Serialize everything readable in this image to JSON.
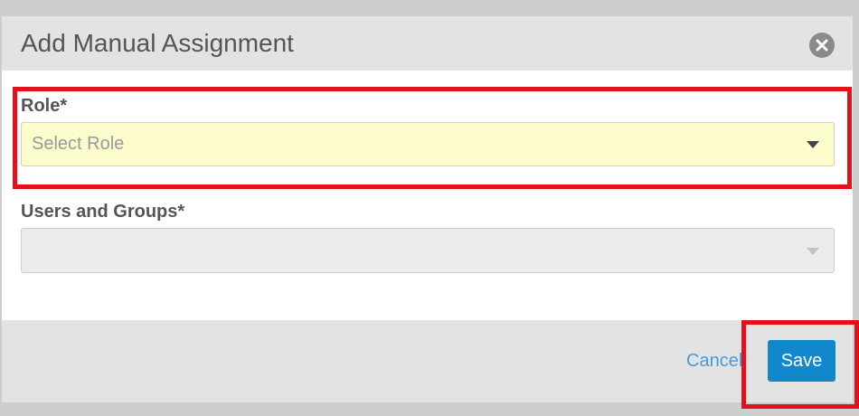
{
  "dialog": {
    "title": "Add Manual Assignment",
    "close_icon": "close-icon"
  },
  "form": {
    "role": {
      "label": "Role*",
      "placeholder": "Select Role",
      "value": "",
      "caret_icon": "caret-down-icon"
    },
    "users_groups": {
      "label": "Users and Groups*",
      "value": "",
      "disabled": true,
      "caret_icon": "caret-down-icon"
    }
  },
  "footer": {
    "cancel_label": "Cancel",
    "save_label": "Save"
  },
  "colors": {
    "accent": "#1188cc",
    "link": "#4a9ad6",
    "highlight": "#e3101e",
    "role_field_bg": "#fcfccc",
    "disabled_field_bg": "#ececec"
  }
}
